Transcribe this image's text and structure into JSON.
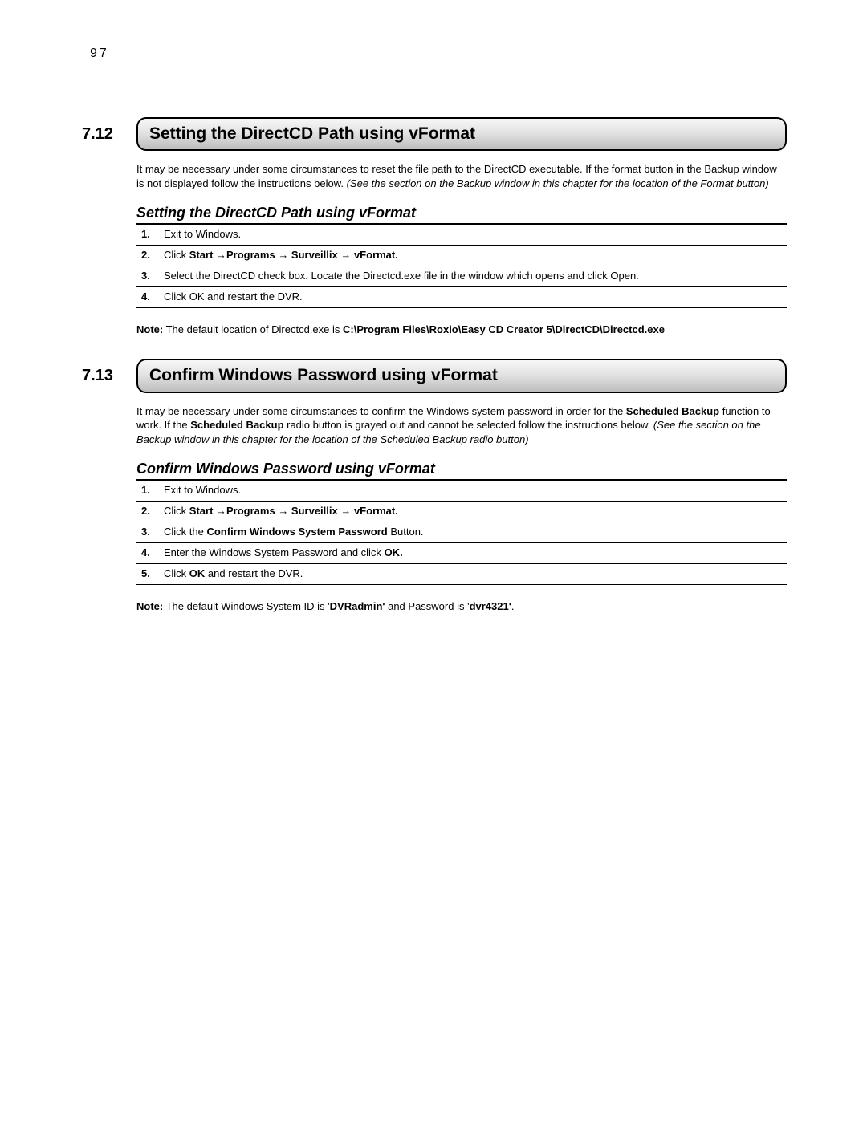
{
  "page_number": "97",
  "section1": {
    "number": "7.12",
    "title": "Setting the DirectCD Path using vFormat",
    "intro_plain": "It may be necessary under some circumstances to reset the file path to the DirectCD executable. If the format button in the Backup window is not displayed follow the instructions below. ",
    "intro_italic": "(See the section on the Backup window in this chapter for the location of the Format button)",
    "subhead": "Setting the DirectCD Path using vFormat",
    "steps": {
      "n1": "1.",
      "t1": "Exit to Windows.",
      "n2": "2.",
      "t2a": "Click ",
      "t2b": "Start →Programs → Surveillix → vFormat.",
      "n3": "3.",
      "t3": "Select the DirectCD check box. Locate the Directcd.exe file in the window which opens and click Open.",
      "n4": "4.",
      "t4": "Click OK and restart the DVR."
    },
    "note_label": "Note:",
    "note_text_a": " The default location of Directcd.exe is  ",
    "note_text_b": "C:\\Program Files\\Roxio\\Easy CD Creator 5\\DirectCD\\Directcd.exe"
  },
  "section2": {
    "number": "7.13",
    "title": "Confirm Windows Password using vFormat",
    "intro_a": "It may be necessary under some circumstances to confirm the Windows system password in order for the ",
    "intro_b": "Scheduled Backup",
    "intro_c": " function to work. If the ",
    "intro_d": "Scheduled Backup",
    "intro_e": " radio button is grayed out and cannot be selected follow the instructions below. ",
    "intro_italic": "(See the section on the Backup window in this chapter for the location of the Scheduled Backup radio button)",
    "subhead": "Confirm Windows Password using vFormat",
    "steps": {
      "n1": "1.",
      "t1": "Exit to Windows.",
      "n2": "2.",
      "t2a": "Click ",
      "t2b": "Start →Programs → Surveillix → vFormat.",
      "n3": "3.",
      "t3a": "Click the ",
      "t3b": "Confirm Windows System Password",
      "t3c": " Button.",
      "n4": "4.",
      "t4a": "Enter the Windows System Password and click ",
      "t4b": "OK.",
      "n5": "5.",
      "t5a": "Click ",
      "t5b": "OK",
      "t5c": " and restart the DVR."
    },
    "note_label": "Note:",
    "note_a": " The default Windows System ID is '",
    "note_b": "DVRadmin'",
    "note_c": " and Password is '",
    "note_d": "dvr4321'",
    "note_e": "."
  }
}
